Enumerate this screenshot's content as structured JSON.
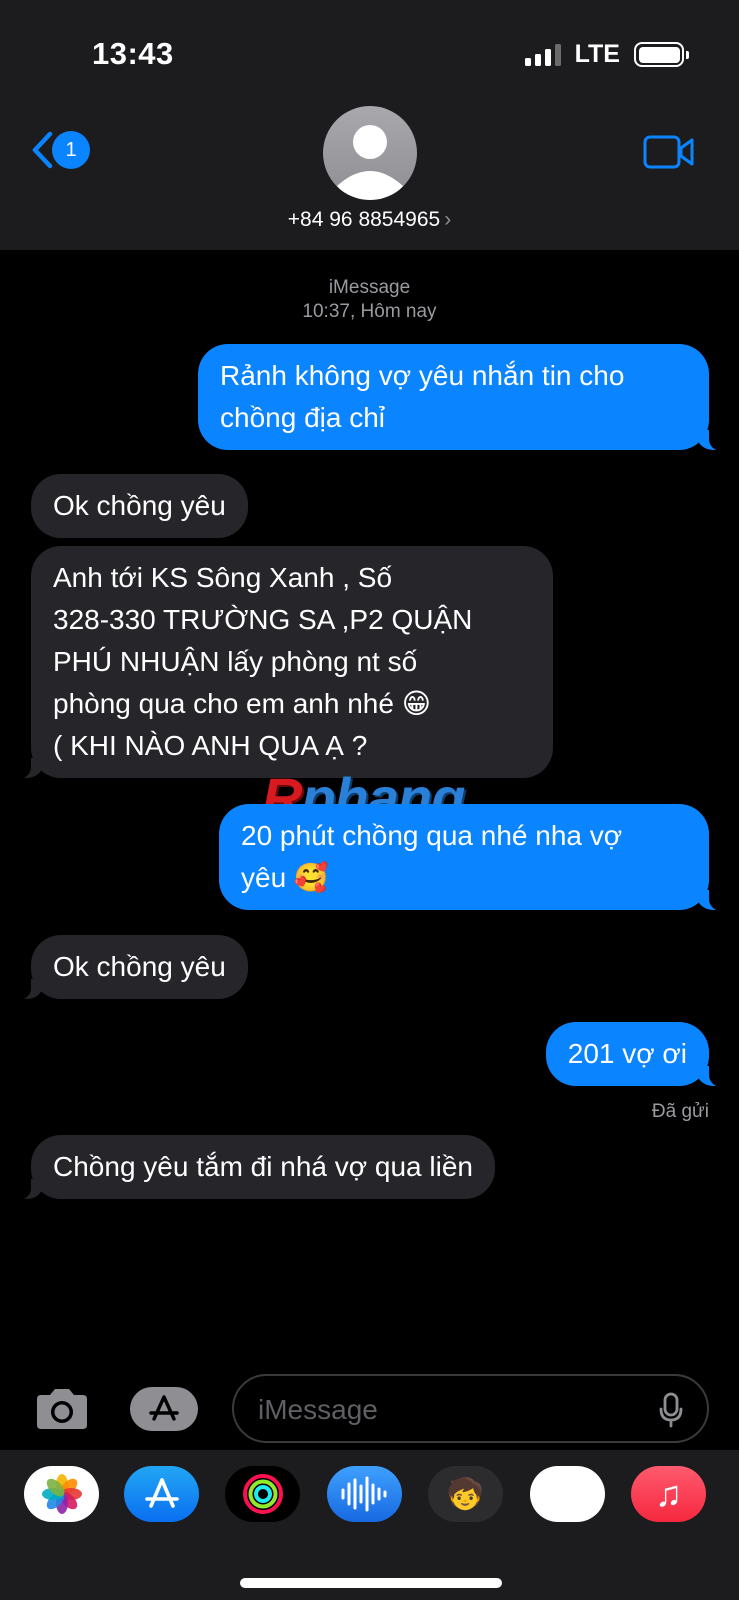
{
  "status_bar": {
    "time": "13:43",
    "network": "LTE"
  },
  "nav": {
    "back_badge": "1",
    "contact_number": "+84 96 8854965",
    "contact_chevron": "›"
  },
  "conversation": {
    "service_label": "iMessage",
    "timestamp": "10:37, Hôm nay",
    "messages": [
      {
        "direction": "sent",
        "lines": [
          "Rảnh không vợ yêu nhắn tin cho",
          "chồng địa chỉ"
        ]
      },
      {
        "direction": "received",
        "lines": [
          "Ok chồng yêu"
        ]
      },
      {
        "direction": "received",
        "lines": [
          "Anh tới KS Sông Xanh , Số",
          "328-330 TRƯỜNG SA ,P2 QUẬN",
          "PHÚ NHUẬN lấy phòng nt số",
          "phòng qua cho em anh nhé 😁",
          "( KHI NÀO ANH QUA Ạ ?"
        ]
      },
      {
        "direction": "sent",
        "lines": [
          "20 phút chồng qua nhé nha vợ",
          "yêu 🥰"
        ]
      },
      {
        "direction": "received",
        "lines": [
          "Ok chồng yêu"
        ]
      },
      {
        "direction": "sent",
        "lines": [
          "201 vợ ơi"
        ]
      },
      {
        "direction": "received",
        "lines": [
          "Chồng yêu tắm đi nhá vợ qua liền"
        ]
      }
    ],
    "delivered_label": "Đã gửi"
  },
  "watermark": {
    "first": "R",
    "rest": "phang"
  },
  "composer": {
    "placeholder": "iMessage"
  },
  "app_drawer": {
    "apps": [
      {
        "name": "photos-app-icon",
        "glyph": ""
      },
      {
        "name": "app-store-icon",
        "glyph": ""
      },
      {
        "name": "activity-icon",
        "glyph": ""
      },
      {
        "name": "audio-message-icon",
        "glyph": ""
      },
      {
        "name": "memoji-icon",
        "glyph": "🧒"
      },
      {
        "name": "memoji-stickers-icon",
        "glyph": "😍"
      },
      {
        "name": "music-app-icon",
        "glyph": "♫"
      }
    ]
  },
  "colors": {
    "sent_bubble": "#0a84ff",
    "received_bubble": "#26262a",
    "header_bg": "#1c1c1e"
  }
}
